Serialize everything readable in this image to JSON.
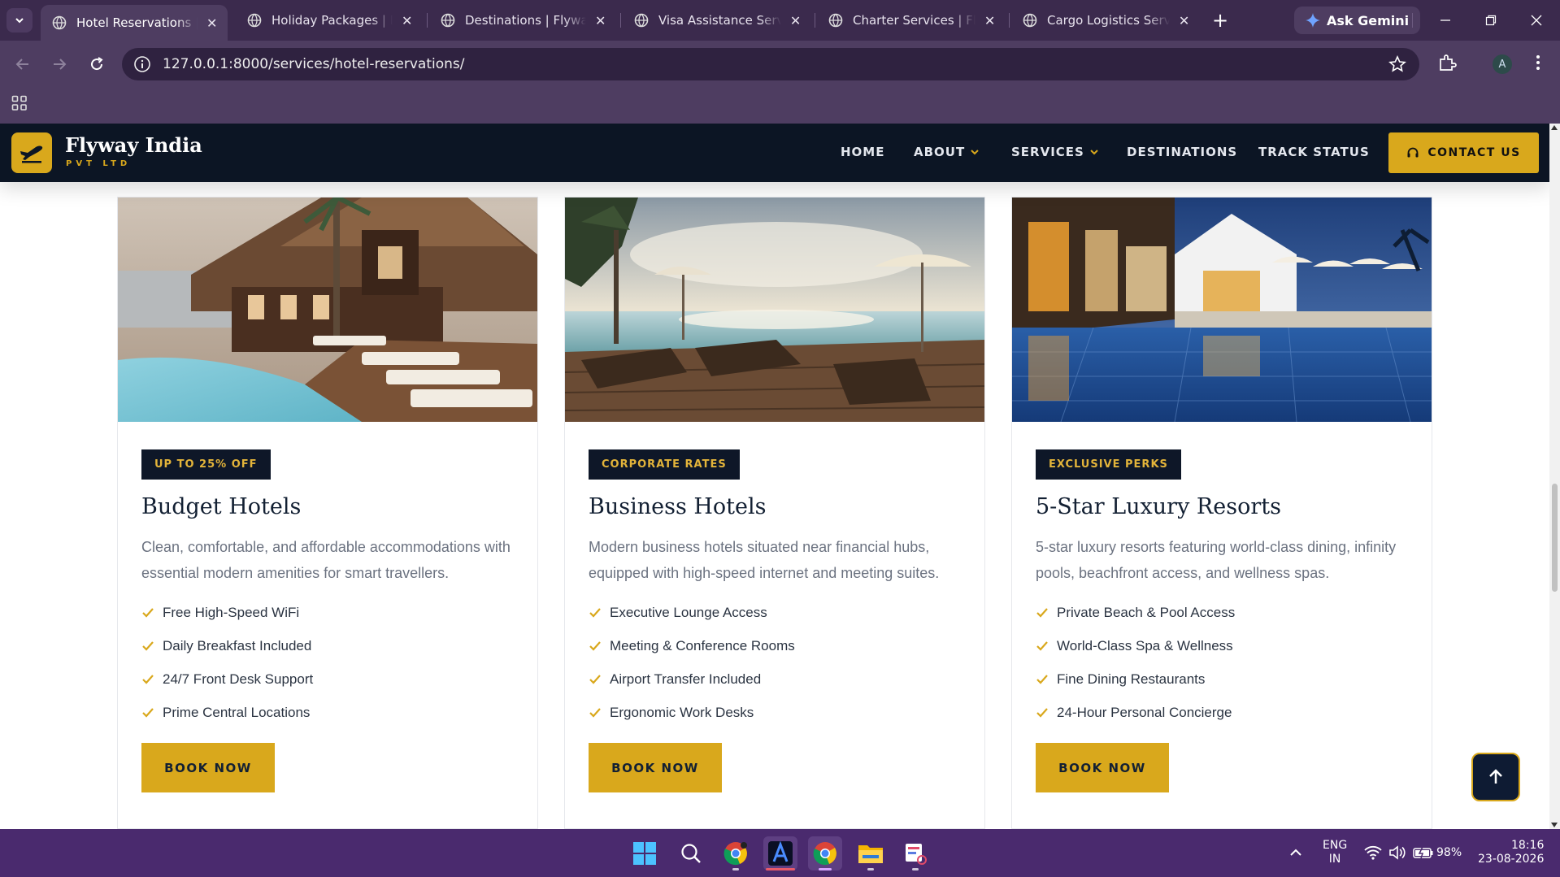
{
  "browser": {
    "tabs": [
      {
        "title": "Hotel Reservations | Flyway India",
        "active": true
      },
      {
        "title": "Holiday Packages | Flyway India",
        "active": false
      },
      {
        "title": "Destinations | Flyway India",
        "active": false
      },
      {
        "title": "Visa Assistance Services | Flyway India",
        "active": false
      },
      {
        "title": "Charter Services | Flyway India",
        "active": false
      },
      {
        "title": "Cargo Logistics Services | Flyway India",
        "active": false
      }
    ],
    "new_tab": "+",
    "gemini_label": "Ask Gemini",
    "url": "127.0.0.1:8000/services/hotel-reservations/",
    "profile_initial": "A",
    "close_glyph": "✕"
  },
  "site": {
    "brand_name": "Flyway India",
    "brand_sub": "PVT LTD",
    "menu": [
      {
        "label": "HOME"
      },
      {
        "label": "ABOUT"
      },
      {
        "label": "SERVICES"
      },
      {
        "label": "DESTINATIONS"
      },
      {
        "label": "TRACK STATUS"
      }
    ],
    "contact_label": "CONTACT US",
    "accent_color": "#d9a81c",
    "navy_color": "#0c1524"
  },
  "cards": [
    {
      "badge": "UP TO 25% OFF",
      "title": "Budget Hotels",
      "description": "Clean, comfortable, and affordable accommodations with essential modern amenities for smart travellers.",
      "features": [
        "Free High-Speed WiFi",
        "Daily Breakfast Included",
        "24/7 Front Desk Support",
        "Prime Central Locations"
      ],
      "button": "BOOK NOW"
    },
    {
      "badge": "CORPORATE RATES",
      "title": "Business Hotels",
      "description": "Modern business hotels situated near financial hubs, equipped with high-speed internet and meeting suites.",
      "features": [
        "Executive Lounge Access",
        "Meeting & Conference Rooms",
        "Airport Transfer Included",
        "Ergonomic Work Desks"
      ],
      "button": "BOOK NOW"
    },
    {
      "badge": "EXCLUSIVE PERKS",
      "title": "5-Star Luxury Resorts",
      "description": "5-star luxury resorts featuring world-class dining, infinity pools, beachfront access, and wellness spas.",
      "features": [
        "Private Beach & Pool Access",
        "World-Class Spa & Wellness",
        "Fine Dining Restaurants",
        "24-Hour Personal Concierge"
      ],
      "button": "BOOK NOW"
    }
  ],
  "taskbar": {
    "language": "ENG",
    "region": "IN",
    "battery": "98%",
    "time": "18:16",
    "date": "23-08-2026"
  }
}
